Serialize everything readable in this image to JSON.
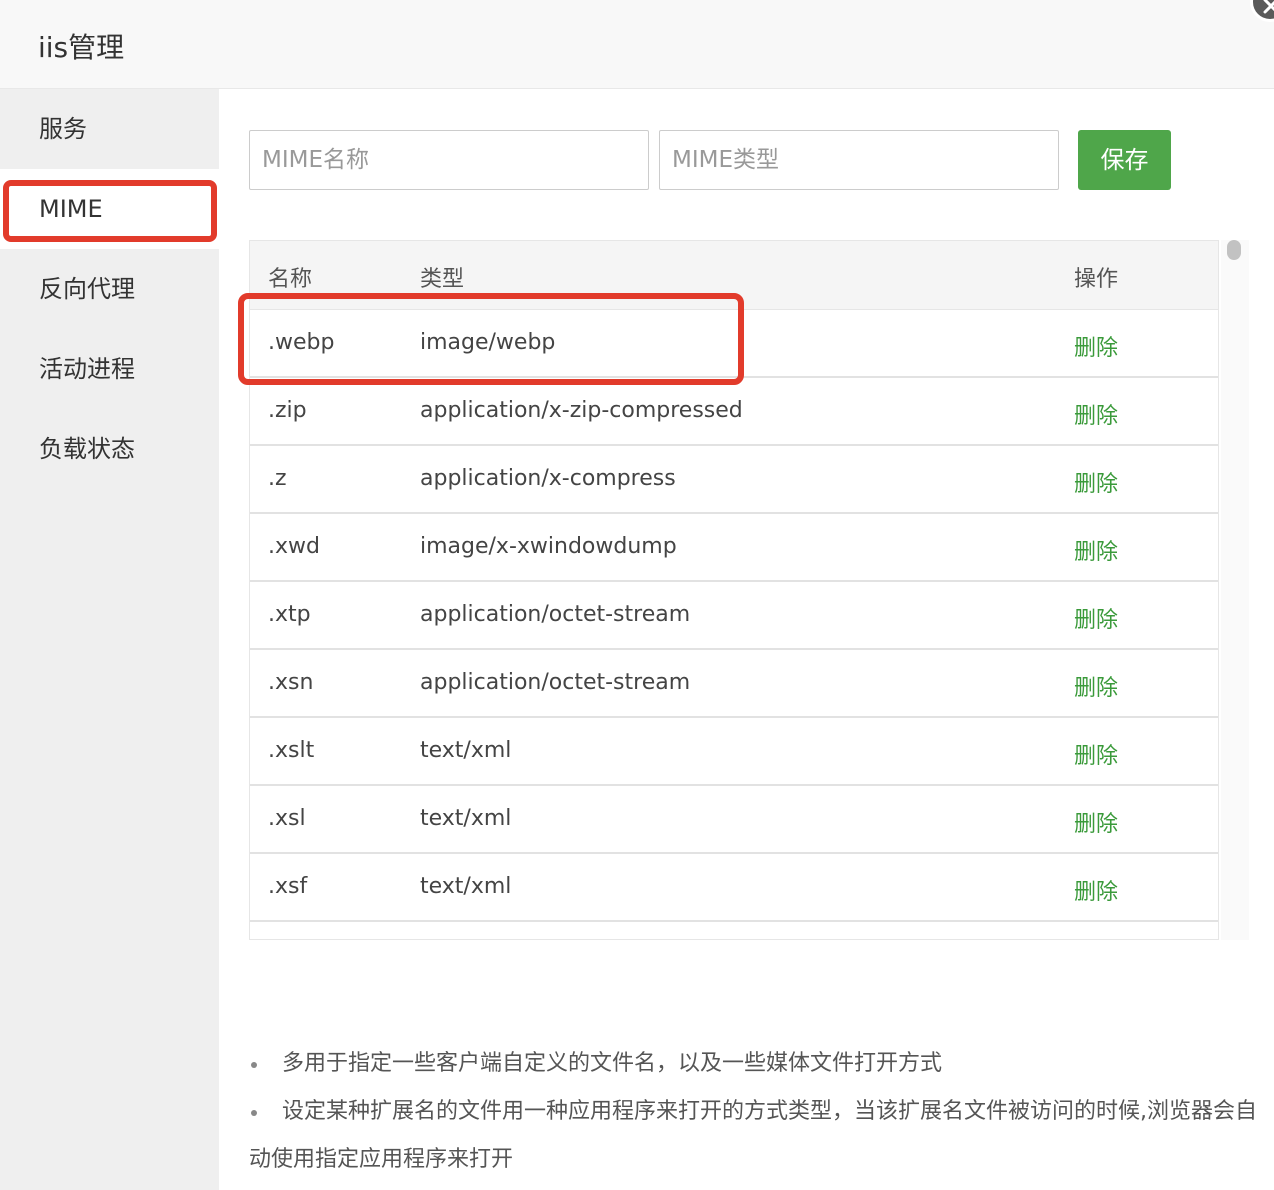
{
  "window": {
    "title": "iis管理"
  },
  "sidebar": {
    "items": [
      {
        "label": "服务"
      },
      {
        "label": "MIME"
      },
      {
        "label": "反向代理"
      },
      {
        "label": "活动进程"
      },
      {
        "label": "负载状态"
      }
    ],
    "active_index": 1
  },
  "form": {
    "name_placeholder": "MIME名称",
    "type_placeholder": "MIME类型",
    "save_label": "保存"
  },
  "table": {
    "headers": {
      "name": "名称",
      "type": "类型",
      "action": "操作"
    },
    "rows": [
      {
        "name": ".webp",
        "type": "image/webp",
        "action": "删除"
      },
      {
        "name": ".zip",
        "type": "application/x-zip-compressed",
        "action": "删除"
      },
      {
        "name": ".z",
        "type": "application/x-compress",
        "action": "删除"
      },
      {
        "name": ".xwd",
        "type": "image/x-xwindowdump",
        "action": "删除"
      },
      {
        "name": ".xtp",
        "type": "application/octet-stream",
        "action": "删除"
      },
      {
        "name": ".xsn",
        "type": "application/octet-stream",
        "action": "删除"
      },
      {
        "name": ".xslt",
        "type": "text/xml",
        "action": "删除"
      },
      {
        "name": ".xsl",
        "type": "text/xml",
        "action": "删除"
      },
      {
        "name": ".xsf",
        "type": "text/xml",
        "action": "删除"
      }
    ]
  },
  "tips": [
    "多用于指定一些客户端自定义的文件名，以及一些媒体文件打开方式",
    "设定某种扩展名的文件用一种应用程序来打开的方式类型，当该扩展名文件被访问的时候,浏览器会自动使用指定应用程序来打开"
  ],
  "colors": {
    "accent_green": "#4fa64a",
    "delete_link": "#3a9a3a",
    "highlight_red": "#e23b2b",
    "sidebar_bg": "#efefef"
  },
  "icons": {
    "close": "close-icon"
  }
}
